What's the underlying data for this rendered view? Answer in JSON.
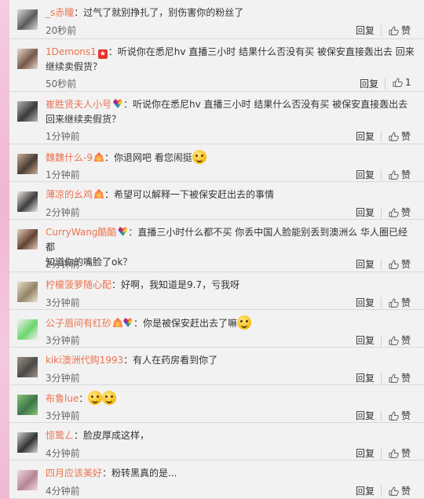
{
  "reply_label": "回复",
  "like_label": "赞",
  "comments": [
    {
      "user": "_s赤瞳",
      "badges": [],
      "text": "：过气了就别挣扎了，别伤害你的粉丝了",
      "text2": "",
      "time": "20秒前",
      "like": "赞",
      "avatar_colors": [
        "#4d4d4d",
        "#d9d9d9"
      ]
    },
    {
      "user": "1Demons1",
      "badges": [
        "star"
      ],
      "text": "：听说你在悉尼hv 直播三小时 结果什么否没有买 被保安直接轰出去 回来",
      "text2": "继续卖假货？",
      "time": "50秒前",
      "like": "1",
      "avatar_colors": [
        "#6a4a3a",
        "#e8d5c8"
      ]
    },
    {
      "user": "崔胜贤夫人小号",
      "badges": [
        "rainbow"
      ],
      "text": "：听说你在悉尼hv 直播三小时 结果什么否没有买 被保安直接轰出去",
      "text2": "回来继续卖假货？",
      "time": "1分钟前",
      "like": "赞",
      "avatar_colors": [
        "#2a2a2a",
        "#b0b0b0"
      ]
    },
    {
      "user": "魏魏什么-9",
      "badges": [
        "fire"
      ],
      "text": "：你退网吧 看您闹挺",
      "text2": "",
      "emoji": 1,
      "time": "1分钟前",
      "like": "赞",
      "avatar_colors": [
        "#3a2b22",
        "#c9a98f"
      ]
    },
    {
      "user": "薄凉的幺鸡",
      "badges": [
        "fire"
      ],
      "text": "：希望可以解释一下被保安赶出去的事情",
      "text2": "",
      "time": "2分钟前",
      "like": "赞",
      "avatar_colors": [
        "#2d2d2d",
        "#f0e6e0"
      ]
    },
    {
      "user": "CurryWang酷酷",
      "badges": [
        "rainbow"
      ],
      "text": "：直播三小时什么都不买 你丢中国人脸能别丢到澳洲么 华人圈已经都",
      "text2": "知道你的嘴脸了ok？",
      "time": "2分钟前",
      "like": "赞",
      "avatar_colors": [
        "#553322",
        "#e6c9b8"
      ]
    },
    {
      "user": "柠檬菠萝随心配",
      "badges": [],
      "text": "：好啊，我知道是9.7，亏我呀",
      "text2": "",
      "time": "3分钟前",
      "like": "赞",
      "avatar_colors": [
        "#8a7a5a",
        "#e8e0c8"
      ]
    },
    {
      "user": "公子眉间有红砂",
      "badges": [
        "fire",
        "rainbow"
      ],
      "text": "：你是被保安赶出去了嘛",
      "text2": "",
      "emoji": 1,
      "time": "3分钟前",
      "like": "赞",
      "avatar_colors": [
        "#5fd35f",
        "#f0f0f0"
      ]
    },
    {
      "user": "kiki澳洲代购1993",
      "badges": [],
      "text": "：有人在药房看到你了",
      "text2": "",
      "time": "3分钟前",
      "like": "赞",
      "avatar_colors": [
        "#3a3a3a",
        "#9a8a7a"
      ]
    },
    {
      "user": "布鲁lue",
      "badges": [],
      "text": "：",
      "text2": "",
      "emoji": 2,
      "time": "3分钟前",
      "like": "赞",
      "avatar_colors": [
        "#2e6b3a",
        "#7fbf6a"
      ]
    },
    {
      "user": "惊鸷ㄥ",
      "badges": [],
      "text": "：脸皮厚成这样，",
      "text2": "",
      "time": "4分钟前",
      "like": "赞",
      "avatar_colors": [
        "#222",
        "#d0d0d0"
      ]
    },
    {
      "user": "四月应该美好",
      "badges": [],
      "text": "：粉转黑真的是...",
      "text2": "",
      "time": "4分钟前",
      "like": "赞",
      "avatar_colors": [
        "#b07a8a",
        "#f0d8e0"
      ]
    }
  ]
}
